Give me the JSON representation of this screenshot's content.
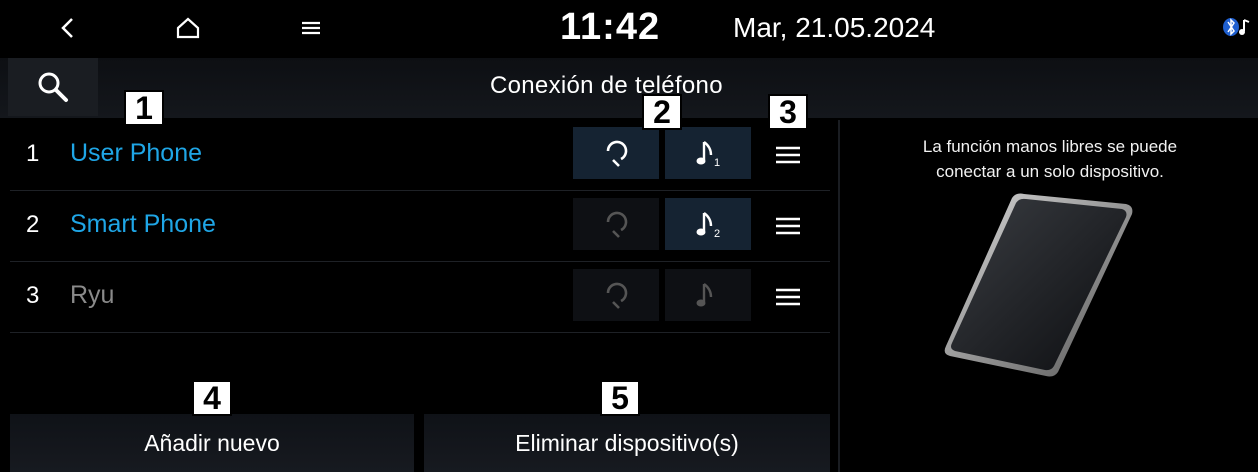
{
  "status_bar": {
    "time": "11:42",
    "date": "Mar, 21.05.2024",
    "icons": [
      "back-icon",
      "home-icon",
      "menu-icon",
      "bluetooth-audio-icon"
    ]
  },
  "header": {
    "title": "Conexión de teléfono",
    "search_icon": "search-icon"
  },
  "devices": [
    {
      "num": "1",
      "name": "User Phone",
      "state": "connected",
      "handsfree": "on",
      "audio": "on",
      "audio_index": "1"
    },
    {
      "num": "2",
      "name": "Smart Phone",
      "state": "connected",
      "handsfree": "off",
      "audio": "on",
      "audio_index": "2"
    },
    {
      "num": "3",
      "name": "Ryu",
      "state": "disconnected",
      "handsfree": "off",
      "audio": "off",
      "audio_index": ""
    }
  ],
  "buttons": {
    "add_new": "Añadir nuevo",
    "delete_devices": "Eliminar dispositivo(s)"
  },
  "info_panel": {
    "line1": "La función manos libres se puede",
    "line2": "conectar a un solo dispositivo."
  },
  "callouts": [
    "1",
    "2",
    "3",
    "4",
    "5"
  ],
  "colors": {
    "accent": "#1fa6e6",
    "disabled": "#8a8a8a",
    "background": "#000000"
  }
}
